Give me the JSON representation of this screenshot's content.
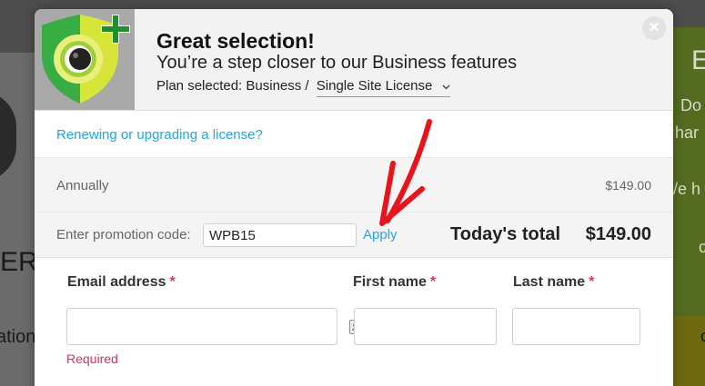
{
  "background": {
    "left_fragments": [
      "ER",
      "ation"
    ],
    "right_fragments": [
      "E",
      "Do",
      "har",
      "/e h",
      "c",
      "c"
    ]
  },
  "modal": {
    "title": "Great selection!",
    "subtitle": "You’re a step closer to our Business features",
    "plan_prefix": "Plan selected: Business /",
    "plan_option": "Single Site License",
    "close_glyph": "×",
    "renew_link": "Renewing or upgrading a license?",
    "billing": {
      "period_label": "Annually",
      "period_price": "$149.00"
    },
    "promo": {
      "label": "Enter promotion code:",
      "code_value": "WPB15",
      "apply_label": "Apply"
    },
    "total": {
      "label": "Today's total",
      "value": "$149.00"
    },
    "form": {
      "email_label": "Email address",
      "first_name_label": "First name",
      "last_name_label": "Last name",
      "required_star": "*",
      "required_msg": "Required"
    }
  },
  "colors": {
    "link": "#27a4d9",
    "required": "#cc3366",
    "arrow": "#e8141c",
    "shield_green": "#2f9e3a",
    "shield_yellow": "#d7e43a"
  },
  "icons": [
    "shield-plus-logo-icon",
    "close-icon",
    "chevron-down-icon",
    "contact-card-icon",
    "red-arrow-annotation"
  ]
}
